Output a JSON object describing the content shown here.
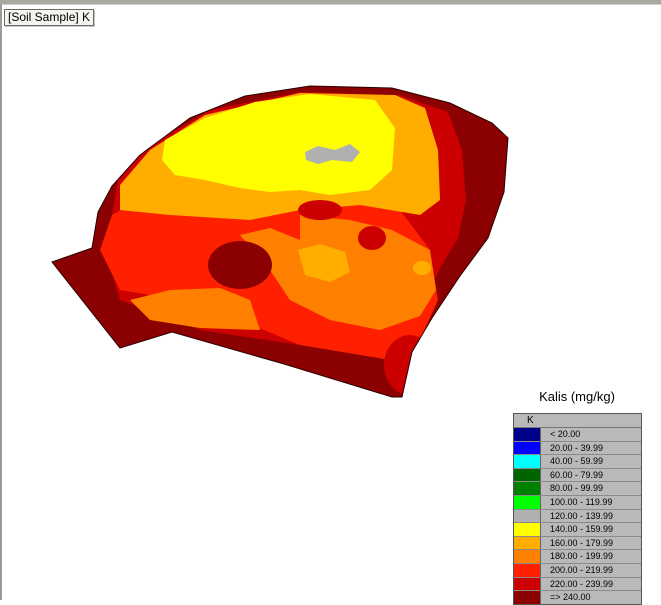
{
  "window": {
    "title": "[Soil Sample] K"
  },
  "legend": {
    "title": "Kalis (mg/kg)",
    "header": "K",
    "classes": [
      {
        "label": "< 20.00",
        "color": "#00008b"
      },
      {
        "label": "20.00 - 39.99",
        "color": "#0000ff"
      },
      {
        "label": "40.00 - 59.99",
        "color": "#00ffff"
      },
      {
        "label": "60.00 - 79.99",
        "color": "#006400"
      },
      {
        "label": "80.00 - 99.99",
        "color": "#008000"
      },
      {
        "label": "100.00 - 119.99",
        "color": "#00ff00"
      },
      {
        "label": "120.00 - 139.99",
        "color": "#b0b0b0"
      },
      {
        "label": "140.00 - 159.99",
        "color": "#ffff00"
      },
      {
        "label": "160.00 - 179.99",
        "color": "#ffae00"
      },
      {
        "label": "180.00 - 199.99",
        "color": "#ff8000"
      },
      {
        "label": "200.00 - 219.99",
        "color": "#ff2000"
      },
      {
        "label": "220.00 - 239.99",
        "color": "#cc0000"
      },
      {
        "label": "=> 240.00",
        "color": "#8b0000"
      }
    ]
  },
  "map": {
    "variable": "K",
    "color_scale": "legend.classes"
  }
}
